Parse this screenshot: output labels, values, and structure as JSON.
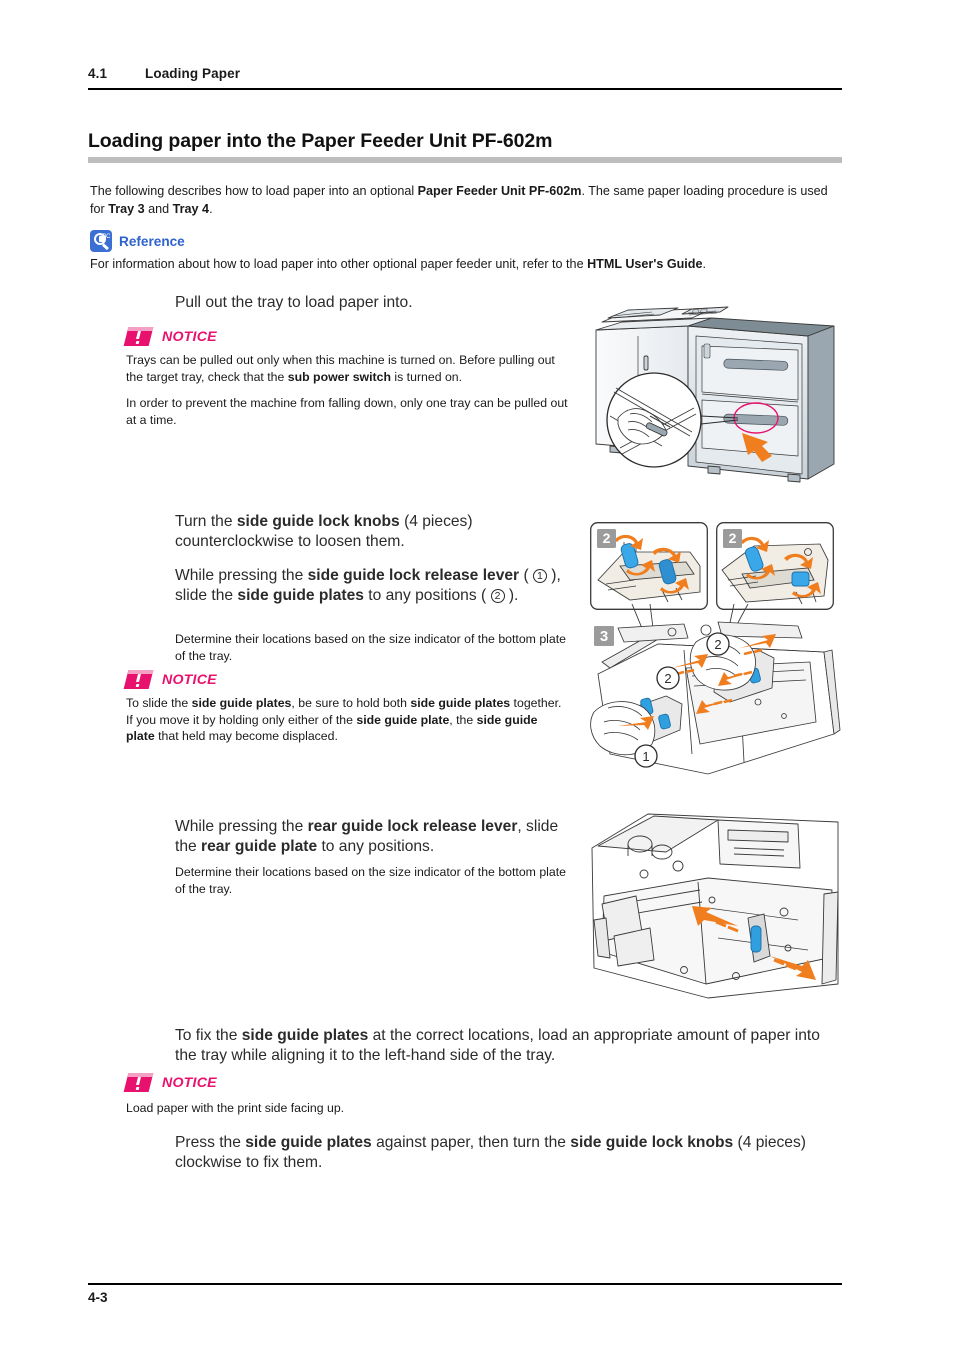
{
  "running_head": {
    "section_number": "4.1",
    "section_title": "Loading Paper"
  },
  "heading": "Loading paper into the Paper Feeder Unit PF-602m",
  "intro": {
    "part1": "The following describes how to load paper into an optional ",
    "bold1": "Paper Feeder Unit PF-602m",
    "part2": ". The same paper loading procedure is used for ",
    "bold2": "Tray 3",
    "part3": " and ",
    "bold3": "Tray 4",
    "part4": "."
  },
  "reference": {
    "icon": "magnifier-abc-icon",
    "label": "Reference",
    "body_part1": "For information about how to load paper into other optional paper feeder unit, refer to the ",
    "body_bold": "HTML User's Guide",
    "body_part2": "."
  },
  "steps": [
    {
      "id": "step-1",
      "text": "Pull out the tray to load paper into.",
      "notice": {
        "label": "NOTICE",
        "paragraphs": [
          {
            "part1": "Trays can be pulled out only when this machine is turned on. Before pulling out the target tray, check that the ",
            "bold": "sub power switch",
            "part2": " is turned on."
          },
          {
            "part1": "In order to prevent the machine from falling down, only one tray can be pulled out at a time.",
            "bold": "",
            "part2": ""
          }
        ]
      }
    },
    {
      "id": "step-2",
      "text_a_part1": "Turn the ",
      "text_a_bold1": "side guide lock knobs",
      "text_a_part2": " (4 pieces) counterclockwise to loosen them.",
      "text_b_part1": "While pressing the ",
      "text_b_bold1": "side guide lock release lever",
      "text_b_part2": " ( ",
      "text_b_circ1": "1",
      "text_b_part3": " ), slide the ",
      "text_b_bold2": "side guide plates",
      "text_b_part4": " to any positions ( ",
      "text_b_circ2": "2",
      "text_b_part5": " ).",
      "sub_text": "Determine their locations based on the size indicator of the bottom plate of the tray.",
      "notice": {
        "label": "NOTICE",
        "part1": "To slide the ",
        "bold1": "side guide plates",
        "part2": ", be sure to hold both ",
        "bold2": "side guide plates",
        "part3": " together. If you move it by holding only either of the ",
        "bold3": "side guide plate",
        "part4": ", the ",
        "bold4": "side guide plate",
        "part5": " that held may become displaced."
      }
    },
    {
      "id": "step-3",
      "text_part1": "While pressing the ",
      "text_bold1": "rear guide lock release lever",
      "text_part2": ", slide the ",
      "text_bold2": "rear guide plate",
      "text_part3": " to any positions.",
      "sub_text": "Determine their locations based on the size indicator of the bottom plate of the tray."
    },
    {
      "id": "step-4",
      "text_part1": "To fix the ",
      "text_bold1": "side guide plates",
      "text_part2": " at the correct locations, load an appropriate amount of paper into the tray while aligning it to the left-hand side of the tray.",
      "notice": {
        "label": "NOTICE",
        "body": "Load paper with the print side facing up."
      }
    },
    {
      "id": "step-5",
      "text_part1": "Press the ",
      "text_bold1": "side guide plates",
      "text_part2": " against paper, then turn the ",
      "text_bold2": "side guide lock knobs",
      "text_part3": " (4 pieces) clockwise to fix them."
    }
  ],
  "figures": {
    "machine": {
      "name": "paper-feeder-machine-illustration",
      "callout_arrow": "pull-out-tray-arrow",
      "magnifier_inset": "hand-grip-handle-detail"
    },
    "knob_detail_left": {
      "name": "side-guide-knob-detail-left",
      "label": "2"
    },
    "knob_detail_right": {
      "name": "side-guide-knob-detail-right",
      "label": "2"
    },
    "tray_overview": {
      "name": "tray-side-guide-plates-illustration",
      "label": "3",
      "callouts": [
        "1",
        "2",
        "2"
      ]
    },
    "rear_guide": {
      "name": "rear-guide-plate-illustration"
    }
  },
  "footer": {
    "folio": "4-3"
  },
  "colors": {
    "notice_pink": "#e8126e",
    "reference_blue": "#2f63cc",
    "heading_bar_gray": "#bdbdbd",
    "arrow_orange": "#f07d1e",
    "knob_blue": "#2f9fe0"
  }
}
